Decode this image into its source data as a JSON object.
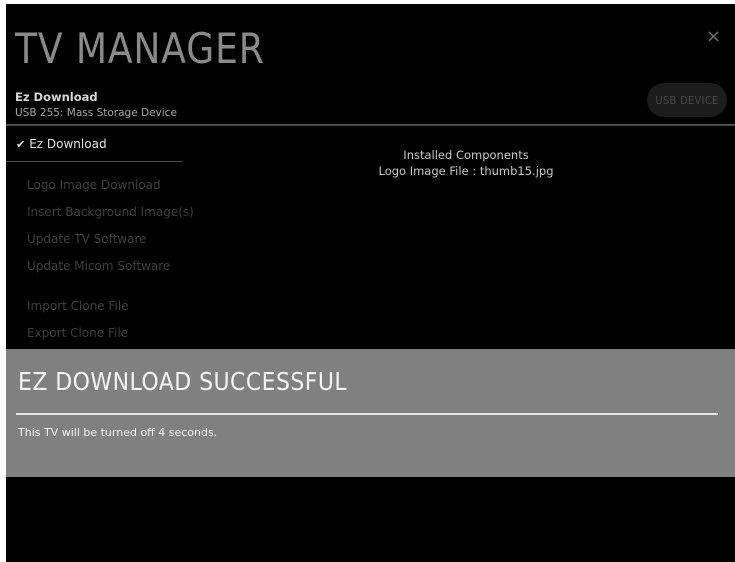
{
  "app": {
    "title": "TV MANAGER",
    "close_glyph": "×"
  },
  "header": {
    "subtitle": "Ez Download",
    "device": "USB 255: Mass Storage Device",
    "usb_button_label": "USB DEVICE"
  },
  "menu": {
    "selected": {
      "check_glyph": "✔",
      "label": "Ez Download"
    },
    "items": [
      {
        "label": "Logo Image Download"
      },
      {
        "label": "Insert Background Image(s)"
      },
      {
        "label": "Update TV Software"
      },
      {
        "label": "Update Micom Software"
      },
      {
        "label": "Import Clone File"
      },
      {
        "label": "Export Clone File"
      }
    ]
  },
  "content": {
    "heading": "Installed Components",
    "detail": "Logo Image File : thumb15.jpg"
  },
  "dialog": {
    "title": "EZ DOWNLOAD SUCCESSFUL",
    "message": "This TV will be turned off 4 seconds."
  },
  "colors": {
    "background": "#000000",
    "dialog": "#808080",
    "title": "#8a8a8a",
    "menu_inactive": "#3f3f3f"
  }
}
